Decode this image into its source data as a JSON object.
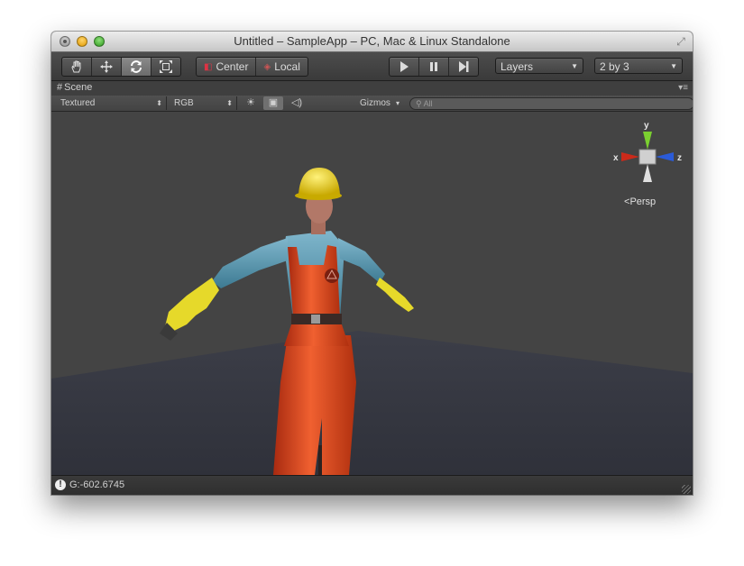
{
  "window": {
    "title": "Untitled – SampleApp – PC, Mac & Linux Standalone"
  },
  "toolbar": {
    "tools": [
      "hand-icon",
      "move-icon",
      "rotate-icon",
      "scale-icon"
    ],
    "active_tool": "rotate-icon",
    "pivot_center_label": "Center",
    "pivot_local_label": "Local",
    "play_controls": [
      "play-icon",
      "pause-icon",
      "step-icon"
    ],
    "layers_label": "Layers",
    "layout_label": "2 by 3"
  },
  "scene": {
    "tab_label": "Scene",
    "render_mode": "Textured",
    "color_mode": "RGB",
    "gizmos_label": "Gizmos",
    "search_placeholder": "All",
    "projection_label": "Persp",
    "axes": {
      "y": "y",
      "x": "x",
      "z": "z"
    },
    "colors": {
      "x_axis": "#cc2a1a",
      "y_axis": "#7bd030",
      "z_axis": "#2b5bd8"
    }
  },
  "status": {
    "message": "G:-602.6745"
  }
}
